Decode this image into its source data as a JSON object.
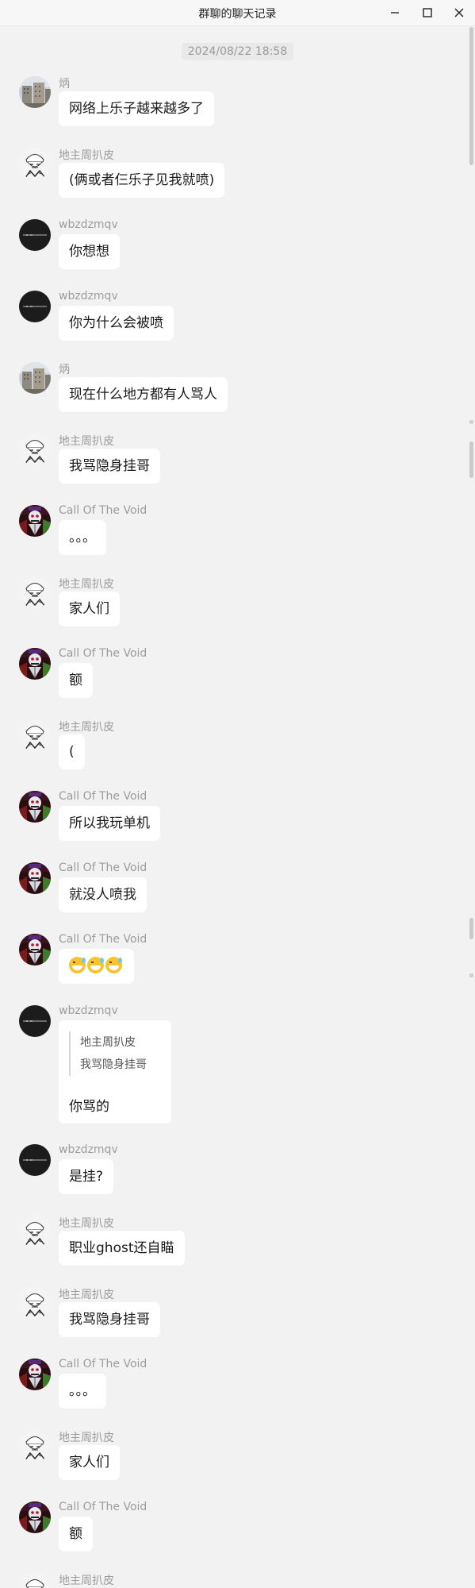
{
  "window": {
    "title": "群聊的聊天记录"
  },
  "timestamp": "2024/08/22 18:58",
  "messages": [
    {
      "sender": "炳",
      "text": "网络上乐子越来越多了"
    },
    {
      "sender": "地主周扒皮",
      "text": "(俩或者仨乐子见我就喷)"
    },
    {
      "sender": "wbzdzmqv",
      "text": "你想想"
    },
    {
      "sender": "wbzdzmqv",
      "text": "你为什么会被喷"
    },
    {
      "sender": "炳",
      "text": "现在什么地方都有人骂人"
    },
    {
      "sender": "地主周扒皮",
      "text": "我骂隐身挂哥"
    },
    {
      "sender": "Call Of The Void",
      "text": "。。。"
    },
    {
      "sender": "地主周扒皮",
      "text": "家人们"
    },
    {
      "sender": "Call Of The Void",
      "text": "额"
    },
    {
      "sender": "地主周扒皮",
      "text": "("
    },
    {
      "sender": "Call Of The Void",
      "text": "所以我玩单机"
    },
    {
      "sender": "Call Of The Void",
      "text": "就没人喷我"
    },
    {
      "sender": "Call Of The Void",
      "text": "",
      "emojis": [
        "grinning-sweat-emoji",
        "grinning-sweat-emoji",
        "grinning-sweat-emoji"
      ]
    },
    {
      "sender": "wbzdzmqv",
      "quote_author": "地主周扒皮",
      "quote_text": "我骂隐身挂哥",
      "text": "你骂的"
    },
    {
      "sender": "wbzdzmqv",
      "text": "是挂?"
    },
    {
      "sender": "地主周扒皮",
      "text": "职业ghost还自瞄"
    },
    {
      "sender": "地主周扒皮",
      "text": "我骂隐身挂哥"
    },
    {
      "sender": "Call Of The Void",
      "text": "。。。"
    },
    {
      "sender": "地主周扒皮",
      "text": "家人们"
    },
    {
      "sender": "Call Of The Void",
      "text": "额"
    },
    {
      "sender": "地主周扒皮",
      "text": ""
    }
  ],
  "icons": {
    "minimize": "minimize-icon",
    "maximize": "maximize-icon",
    "close": "close-icon"
  },
  "colors": {
    "background": "#f2f2f2",
    "bubble": "#ffffff",
    "sender": "#9c9c9c"
  }
}
